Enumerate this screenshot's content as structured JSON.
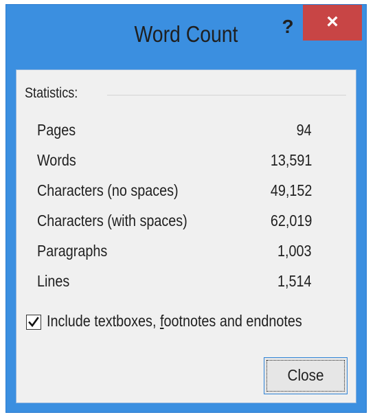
{
  "window": {
    "title": "Word Count",
    "help_label": "?",
    "close_label": "×"
  },
  "statistics": {
    "group_label": "Statistics:",
    "rows": [
      {
        "label": "Pages",
        "value": "94"
      },
      {
        "label": "Words",
        "value": "13,591"
      },
      {
        "label": "Characters (no spaces)",
        "value": "49,152"
      },
      {
        "label": "Characters (with spaces)",
        "value": "62,019"
      },
      {
        "label": "Paragraphs",
        "value": "1,003"
      },
      {
        "label": "Lines",
        "value": "1,514"
      }
    ]
  },
  "options": {
    "include_label_pre": "Include textboxes, ",
    "include_label_accel": "f",
    "include_label_post": "ootnotes and endnotes",
    "include_checked": true
  },
  "buttons": {
    "close_label": "Close"
  },
  "colors": {
    "frame": "#3b8fe0",
    "close_red": "#c84545",
    "client_bg": "#f0f0f0"
  }
}
